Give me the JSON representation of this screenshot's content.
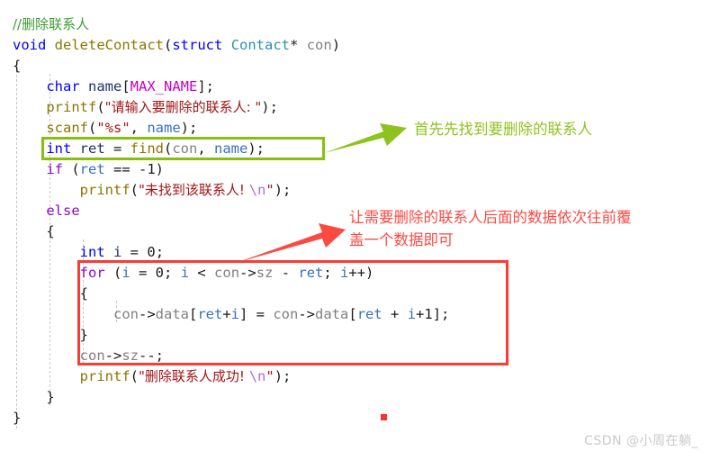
{
  "editor": {
    "language": "c",
    "font_size_px": 15,
    "code_lines": [
      {
        "indent": 0,
        "tokens": [
          {
            "t": "//删除联系人",
            "c": "comment"
          }
        ]
      },
      {
        "indent": 0,
        "tokens": [
          {
            "t": "void",
            "c": "kw"
          },
          {
            "t": " ",
            "c": "plain"
          },
          {
            "t": "deleteContact",
            "c": "fn"
          },
          {
            "t": "(",
            "c": "plain"
          },
          {
            "t": "struct",
            "c": "kw"
          },
          {
            "t": " ",
            "c": "plain"
          },
          {
            "t": "Contact",
            "c": "type"
          },
          {
            "t": "*",
            "c": "plain"
          },
          {
            "t": " ",
            "c": "plain"
          },
          {
            "t": "con",
            "c": "var"
          },
          {
            "t": ")",
            "c": "plain"
          }
        ]
      },
      {
        "indent": 0,
        "tokens": [
          {
            "t": "{",
            "c": "plain"
          }
        ]
      },
      {
        "indent": 1,
        "tokens": [
          {
            "t": "char",
            "c": "kw"
          },
          {
            "t": " ",
            "c": "plain"
          },
          {
            "t": "name",
            "c": "navy"
          },
          {
            "t": "[",
            "c": "plain"
          },
          {
            "t": "MAX_NAME",
            "c": "macro"
          },
          {
            "t": "];",
            "c": "plain"
          }
        ]
      },
      {
        "indent": 1,
        "tokens": [
          {
            "t": "printf",
            "c": "fn"
          },
          {
            "t": "(",
            "c": "plain"
          },
          {
            "t": "\"请输入要删除的联系人: \"",
            "c": "str"
          },
          {
            "t": ");",
            "c": "plain"
          }
        ]
      },
      {
        "indent": 1,
        "tokens": [
          {
            "t": "scanf",
            "c": "fn"
          },
          {
            "t": "(",
            "c": "plain"
          },
          {
            "t": "\"%s\"",
            "c": "str"
          },
          {
            "t": ", ",
            "c": "plain"
          },
          {
            "t": "name",
            "c": "var2"
          },
          {
            "t": ");",
            "c": "plain"
          }
        ]
      },
      {
        "indent": 1,
        "tokens": [
          {
            "t": "int",
            "c": "kw"
          },
          {
            "t": " ",
            "c": "plain"
          },
          {
            "t": "ret",
            "c": "navy"
          },
          {
            "t": " = ",
            "c": "plain"
          },
          {
            "t": "find",
            "c": "fn"
          },
          {
            "t": "(",
            "c": "plain"
          },
          {
            "t": "con",
            "c": "var"
          },
          {
            "t": ", ",
            "c": "plain"
          },
          {
            "t": "name",
            "c": "var2"
          },
          {
            "t": ");",
            "c": "plain"
          }
        ]
      },
      {
        "indent": 1,
        "tokens": [
          {
            "t": "if",
            "c": "kw2"
          },
          {
            "t": " (",
            "c": "plain"
          },
          {
            "t": "ret",
            "c": "var2"
          },
          {
            "t": " == ",
            "c": "plain"
          },
          {
            "t": "-1",
            "c": "num"
          },
          {
            "t": ")",
            "c": "plain"
          }
        ]
      },
      {
        "indent": 2,
        "tokens": [
          {
            "t": "printf",
            "c": "fn"
          },
          {
            "t": "(",
            "c": "plain"
          },
          {
            "t": "\"未找到该联系人! ",
            "c": "str"
          },
          {
            "t": "\\n",
            "c": "esc"
          },
          {
            "t": "\"",
            "c": "str"
          },
          {
            "t": ");",
            "c": "plain"
          }
        ]
      },
      {
        "indent": 1,
        "tokens": [
          {
            "t": "else",
            "c": "kw2"
          }
        ]
      },
      {
        "indent": 1,
        "tokens": [
          {
            "t": "{",
            "c": "plain"
          }
        ]
      },
      {
        "indent": 2,
        "tokens": [
          {
            "t": "int",
            "c": "kw"
          },
          {
            "t": " ",
            "c": "plain"
          },
          {
            "t": "i",
            "c": "navy"
          },
          {
            "t": " = ",
            "c": "plain"
          },
          {
            "t": "0",
            "c": "num"
          },
          {
            "t": ";",
            "c": "plain"
          }
        ]
      },
      {
        "indent": 2,
        "tokens": [
          {
            "t": "for",
            "c": "kw2"
          },
          {
            "t": " (",
            "c": "plain"
          },
          {
            "t": "i",
            "c": "var2"
          },
          {
            "t": " = ",
            "c": "plain"
          },
          {
            "t": "0",
            "c": "num"
          },
          {
            "t": "; ",
            "c": "plain"
          },
          {
            "t": "i",
            "c": "var2"
          },
          {
            "t": " < ",
            "c": "plain"
          },
          {
            "t": "con",
            "c": "var"
          },
          {
            "t": "->",
            "c": "plain"
          },
          {
            "t": "sz",
            "c": "var"
          },
          {
            "t": " - ",
            "c": "plain"
          },
          {
            "t": "ret",
            "c": "var2"
          },
          {
            "t": "; ",
            "c": "plain"
          },
          {
            "t": "i",
            "c": "var2"
          },
          {
            "t": "++)",
            "c": "plain"
          }
        ]
      },
      {
        "indent": 2,
        "tokens": [
          {
            "t": "{",
            "c": "plain"
          }
        ]
      },
      {
        "indent": 3,
        "tokens": [
          {
            "t": "con",
            "c": "var"
          },
          {
            "t": "->",
            "c": "plain"
          },
          {
            "t": "data",
            "c": "var"
          },
          {
            "t": "[",
            "c": "plain"
          },
          {
            "t": "ret",
            "c": "var2"
          },
          {
            "t": "+",
            "c": "plain"
          },
          {
            "t": "i",
            "c": "var2"
          },
          {
            "t": "] = ",
            "c": "plain"
          },
          {
            "t": "con",
            "c": "var"
          },
          {
            "t": "->",
            "c": "plain"
          },
          {
            "t": "data",
            "c": "var"
          },
          {
            "t": "[",
            "c": "plain"
          },
          {
            "t": "ret",
            "c": "var2"
          },
          {
            "t": " + ",
            "c": "plain"
          },
          {
            "t": "i",
            "c": "var2"
          },
          {
            "t": "+",
            "c": "plain"
          },
          {
            "t": "1",
            "c": "num"
          },
          {
            "t": "];",
            "c": "plain"
          }
        ]
      },
      {
        "indent": 2,
        "tokens": [
          {
            "t": "}",
            "c": "plain"
          }
        ]
      },
      {
        "indent": 2,
        "tokens": [
          {
            "t": "con",
            "c": "var"
          },
          {
            "t": "->",
            "c": "plain"
          },
          {
            "t": "sz",
            "c": "var"
          },
          {
            "t": "--;",
            "c": "plain"
          }
        ]
      },
      {
        "indent": 2,
        "tokens": [
          {
            "t": "printf",
            "c": "fn"
          },
          {
            "t": "(",
            "c": "plain"
          },
          {
            "t": "\"删除联系人成功! ",
            "c": "str"
          },
          {
            "t": "\\n",
            "c": "esc"
          },
          {
            "t": "\"",
            "c": "str"
          },
          {
            "t": ");",
            "c": "plain"
          }
        ]
      },
      {
        "indent": 1,
        "tokens": [
          {
            "t": "}",
            "c": "plain"
          }
        ]
      },
      {
        "indent": 0,
        "tokens": [
          {
            "t": "}",
            "c": "plain"
          }
        ]
      }
    ]
  },
  "annotations": {
    "green": {
      "text": "首先先找到要删除的联系人",
      "color": "#8ec31f"
    },
    "red": {
      "text": "让需要删除的联系人后面的数据依次往前覆\n盖一个数据即可",
      "color": "#fb4a42"
    }
  },
  "highlights": {
    "green_box": {
      "color": "#86c00d",
      "targets": "int ret = find(con, name);"
    },
    "red_box": {
      "color": "#fc3b34",
      "targets": "for loop block and con->sz--;"
    }
  },
  "watermark": {
    "text": "CSDN @小周在躺_",
    "color": "#c9c9c9"
  }
}
